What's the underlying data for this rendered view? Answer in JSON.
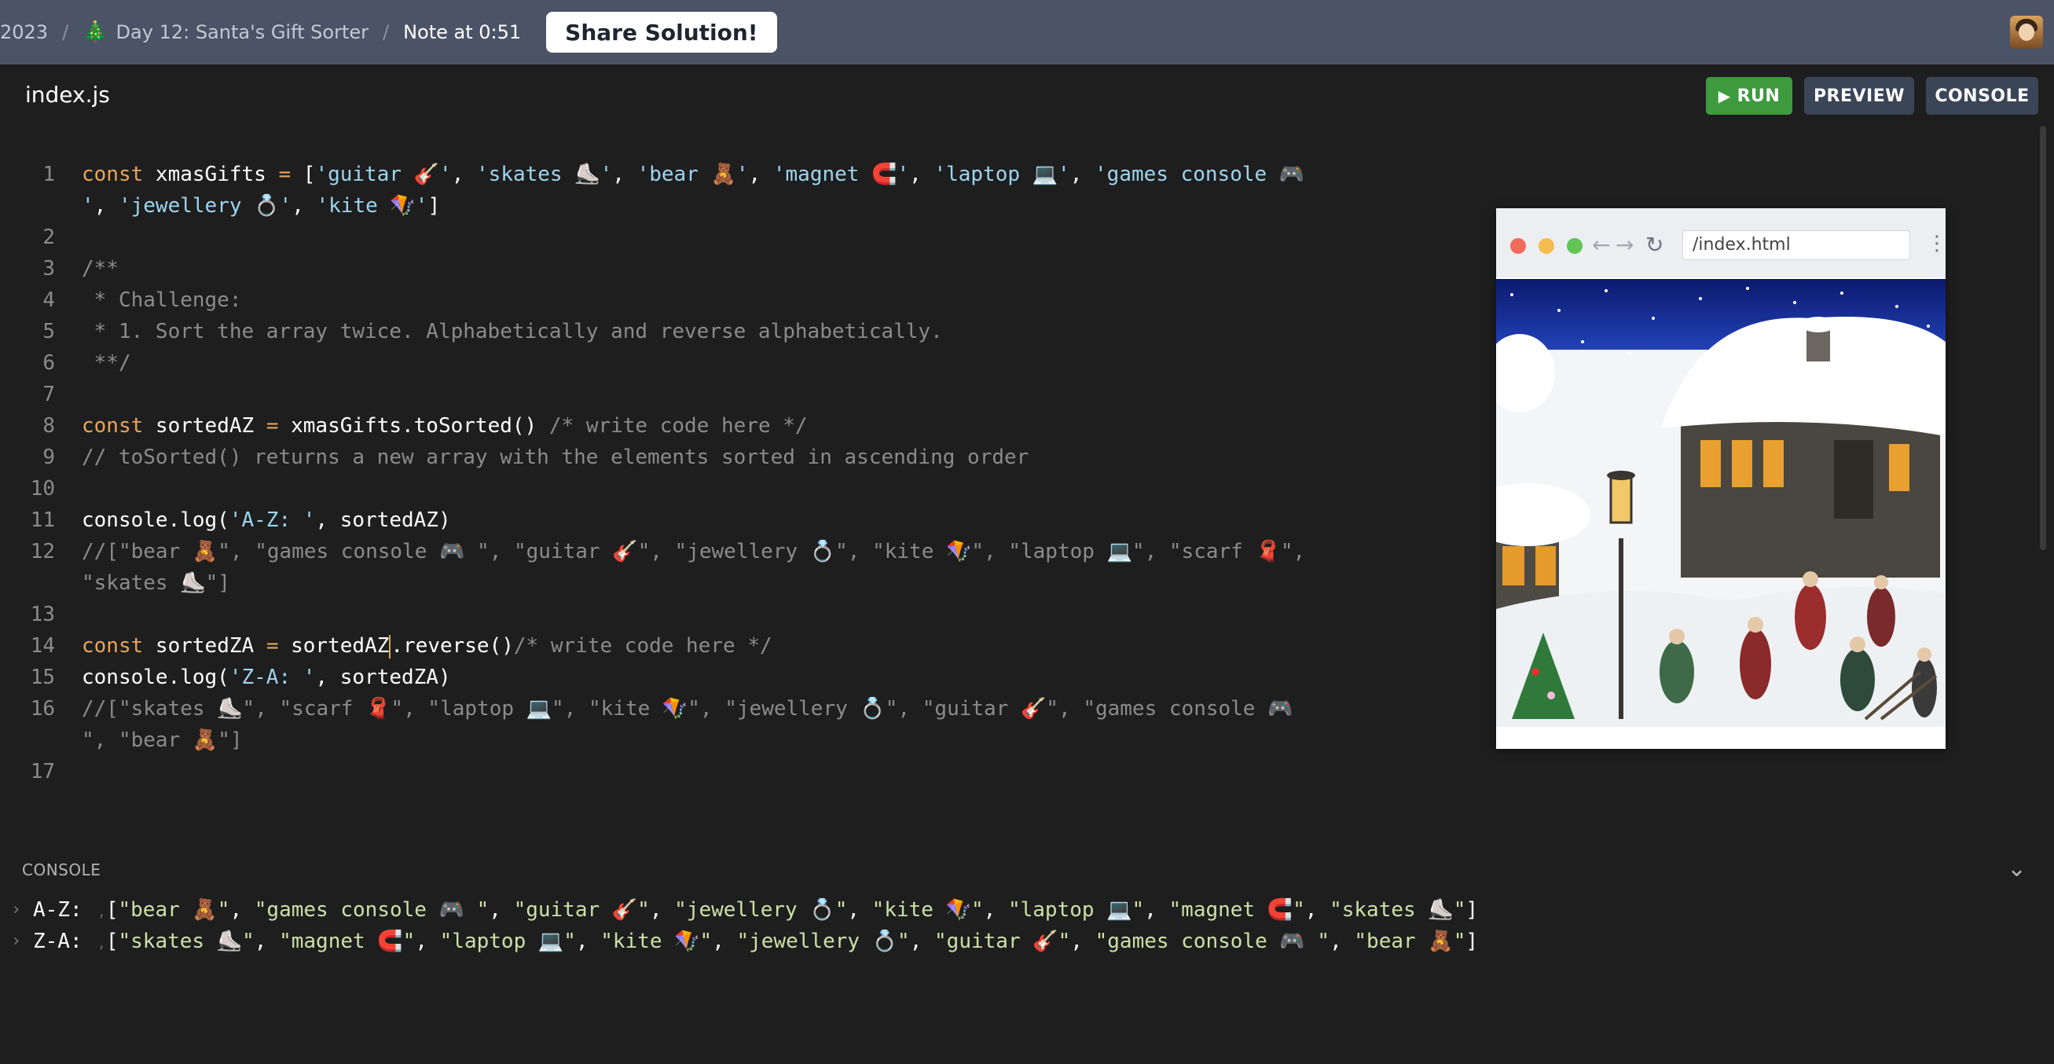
{
  "topbar": {
    "year": "2023",
    "day": "Day 12: Santa's Gift Sorter",
    "note": "Note at 0:51",
    "share": "Share Solution!"
  },
  "file": {
    "name": "index.js"
  },
  "buttons": {
    "run": "RUN",
    "preview": "PREVIEW",
    "console": "CONSOLE"
  },
  "editor": {
    "line_numbers": [
      "1",
      "",
      "2",
      "3",
      "4",
      "5",
      "6",
      "7",
      "8",
      "9",
      "10",
      "11",
      "12",
      "",
      "13",
      "14",
      "15",
      "16",
      "",
      "17"
    ],
    "lines": [
      [
        [
          "kw",
          "const "
        ],
        [
          "txt",
          "xmasGifts "
        ],
        [
          "kw",
          "= "
        ],
        [
          "txt",
          "["
        ],
        [
          "str",
          "'guitar 🎸'"
        ],
        [
          "txt",
          ", "
        ],
        [
          "str",
          "'skates ⛸️'"
        ],
        [
          "txt",
          ", "
        ],
        [
          "str",
          "'bear 🧸'"
        ],
        [
          "txt",
          ", "
        ],
        [
          "str",
          "'magnet 🧲'"
        ],
        [
          "txt",
          ", "
        ],
        [
          "str",
          "'laptop 💻'"
        ],
        [
          "txt",
          ", "
        ],
        [
          "str",
          "'games console 🎮"
        ]
      ],
      [
        [
          "str",
          "'"
        ],
        [
          "txt",
          ", "
        ],
        [
          "str",
          "'jewellery 💍'"
        ],
        [
          "txt",
          ", "
        ],
        [
          "str",
          "'kite 🪁'"
        ],
        [
          "txt",
          "]"
        ]
      ],
      [],
      [
        [
          "cmt",
          "/**"
        ]
      ],
      [
        [
          "cmt",
          " * Challenge:"
        ]
      ],
      [
        [
          "cmt",
          " * 1. Sort the array twice. Alphabetically and reverse alphabetically."
        ]
      ],
      [
        [
          "cmt",
          " **/"
        ]
      ],
      [],
      [
        [
          "kw",
          "const "
        ],
        [
          "txt",
          "sortedAZ "
        ],
        [
          "kw",
          "= "
        ],
        [
          "txt",
          "xmasGifts.toSorted() "
        ],
        [
          "cmt",
          "/* write code here */"
        ]
      ],
      [
        [
          "cmt",
          "// toSorted() returns a new array with the elements sorted in ascending order"
        ]
      ],
      [],
      [
        [
          "txt",
          "console.log("
        ],
        [
          "str",
          "'A-Z: '"
        ],
        [
          "txt",
          ", sortedAZ)"
        ]
      ],
      [
        [
          "cmt",
          "//[\"bear 🧸\", \"games console 🎮 \", \"guitar 🎸\", \"jewellery 💍\", \"kite 🪁\", \"laptop 💻\", \"scarf 🧣\","
        ]
      ],
      [
        [
          "cmt",
          "\"skates ⛸️\"]"
        ]
      ],
      [],
      [
        [
          "kw",
          "const "
        ],
        [
          "txt",
          "sortedZA "
        ],
        [
          "kw",
          "= "
        ],
        [
          "txt",
          "sortedAZ"
        ],
        [
          "cursor",
          ""
        ],
        [
          "txt",
          ".reverse()"
        ],
        [
          "cmt",
          "/* write code here */"
        ]
      ],
      [
        [
          "txt",
          "console.log("
        ],
        [
          "str",
          "'Z-A: '"
        ],
        [
          "txt",
          ", sortedZA)"
        ]
      ],
      [
        [
          "cmt",
          "//[\"skates ⛸️\", \"scarf 🧣\", \"laptop 💻\", \"kite 🪁\", \"jewellery 💍\", \"guitar 🎸\", \"games console 🎮"
        ]
      ],
      [
        [
          "cmt",
          "\", \"bear 🧸\"]"
        ]
      ],
      []
    ]
  },
  "preview": {
    "url": "/index.html",
    "image": "winter-village-scene"
  },
  "console": {
    "label": "CONSOLE",
    "lines": [
      {
        "label": "A-Z:",
        "items": [
          "bear 🧸",
          "games console 🎮 ",
          "guitar 🎸",
          "jewellery 💍",
          "kite 🪁",
          "laptop 💻",
          "magnet 🧲",
          "skates ⛸️"
        ]
      },
      {
        "label": "Z-A:",
        "items": [
          "skates ⛸️",
          "magnet 🧲",
          "laptop 💻",
          "kite 🪁",
          "jewellery 💍",
          "guitar 🎸",
          "games console 🎮 ",
          "bear 🧸"
        ]
      }
    ]
  },
  "colors": {
    "topbar": "#4a5466",
    "editor_bg": "#1e1e1e",
    "keyword": "#e8a45a",
    "string": "#9cd5f0",
    "comment": "#8b8b8b",
    "run": "#3d9a3d"
  }
}
